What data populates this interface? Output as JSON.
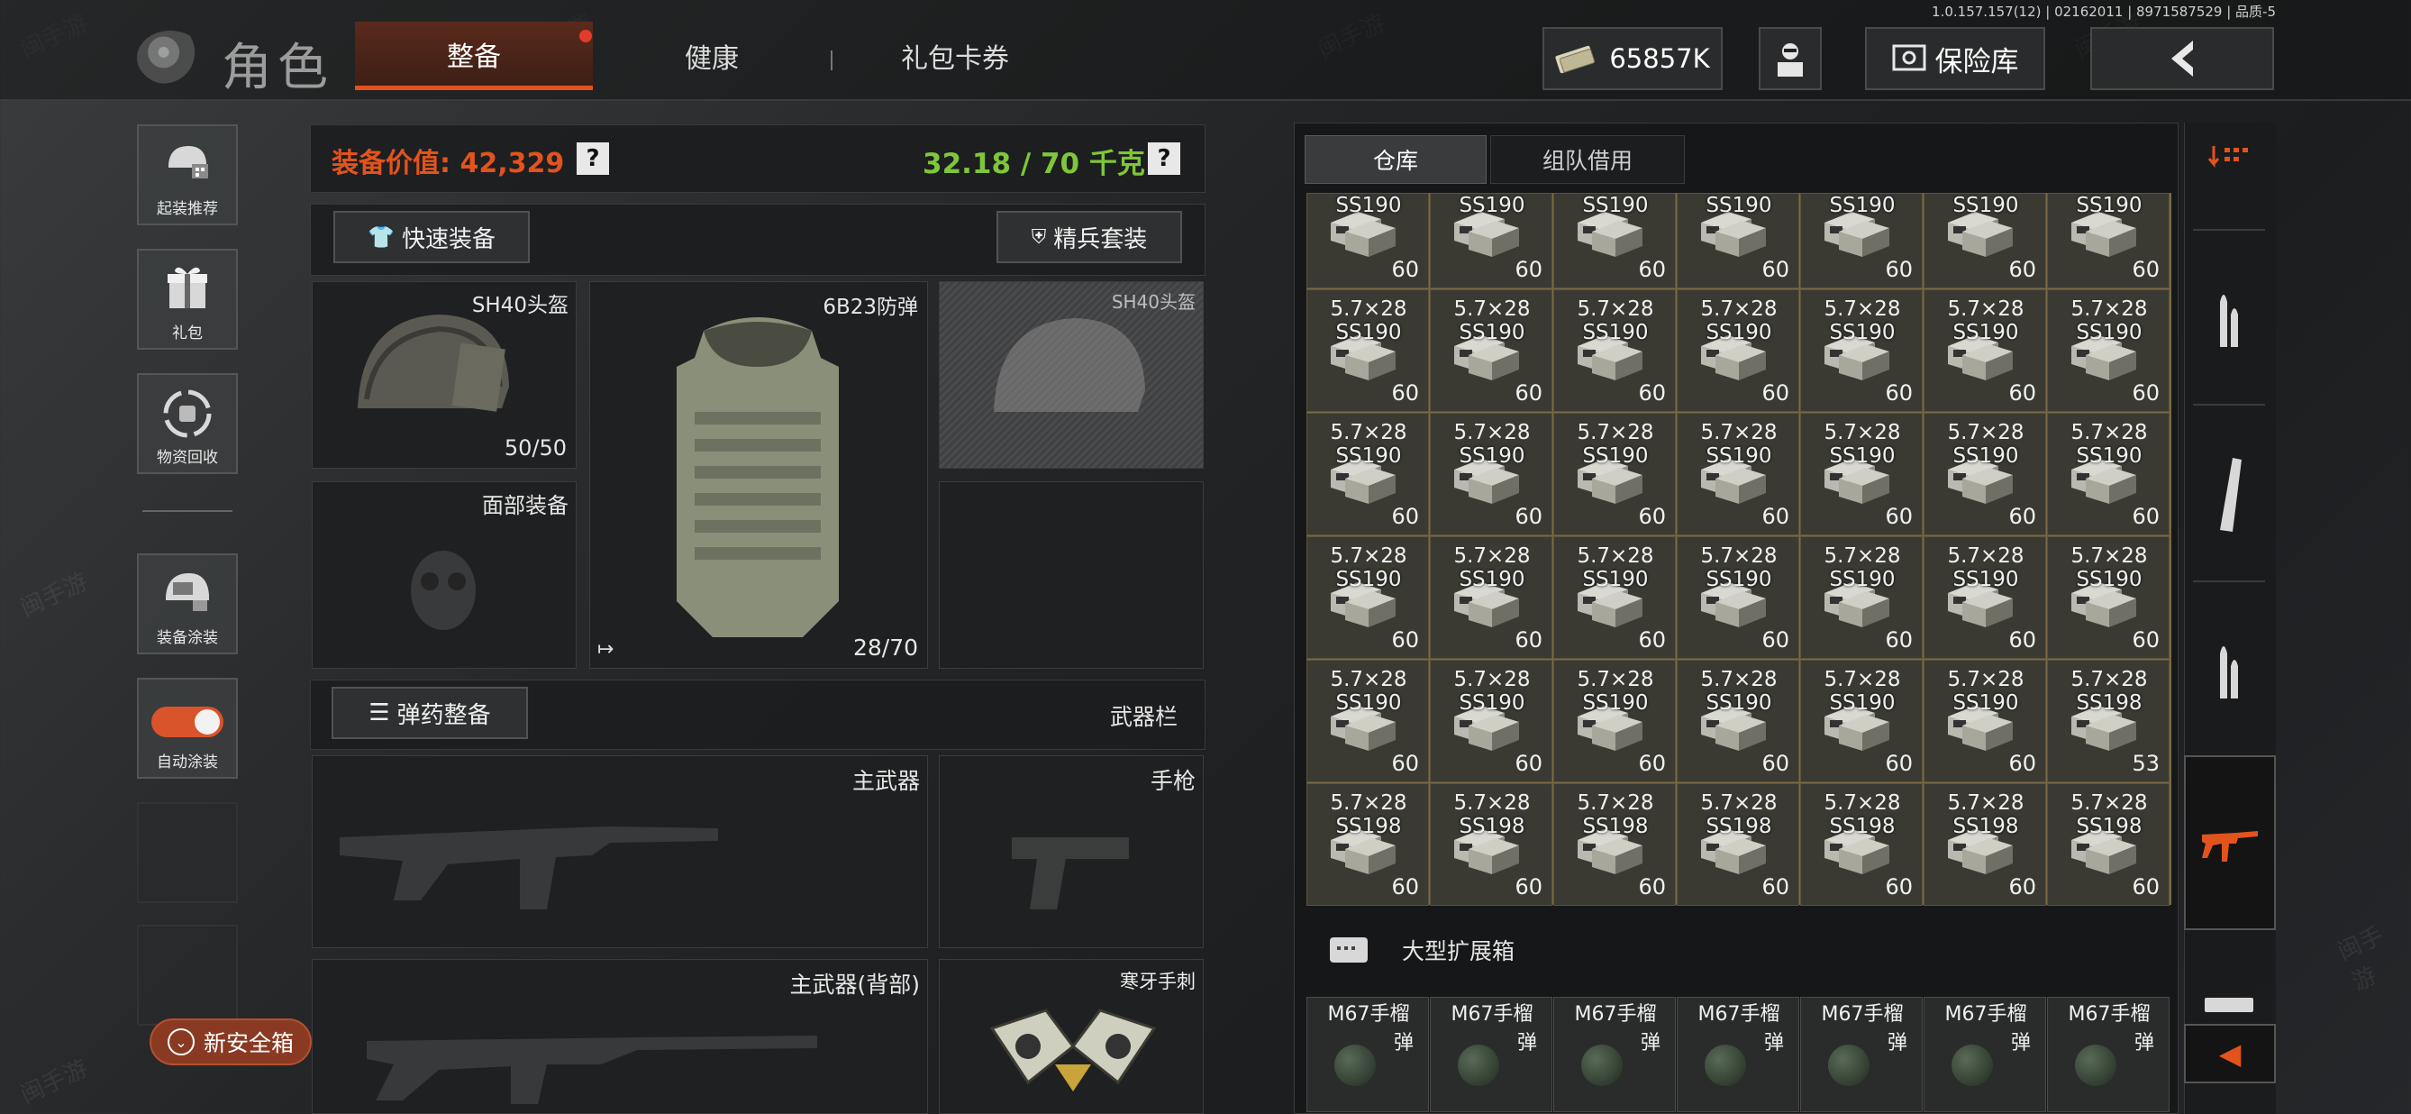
{
  "version": "1.0.157.157(12) | 02162011 | 8971587529 | 品质-5",
  "header": {
    "title": "角色",
    "tabs": [
      "整备",
      "健康",
      "礼包卡券"
    ],
    "currency": "65857K",
    "vault_label": "保险库"
  },
  "sidebar": {
    "items": [
      {
        "label": "起装推荐",
        "icon": "helmet-gun-icon"
      },
      {
        "label": "礼包",
        "icon": "gift-icon"
      },
      {
        "label": "物资回收",
        "icon": "recycle-icon"
      },
      {
        "label": "装备涂装",
        "icon": "helmet-paint-icon"
      },
      {
        "label": "自动涂装",
        "icon": "toggle-icon"
      }
    ],
    "safebox_label": "新安全箱"
  },
  "equipment": {
    "value_label": "装备价值: 42,329",
    "weight_label": "32.18 / 70 千克",
    "quick_equip": "快速装备",
    "elite_set": "精兵套装",
    "helmet_label": "SH40头盔",
    "helmet_durability": "50/50",
    "armor_label": "6B23防弹",
    "armor_durability": "28/70",
    "helmet_ghost_label": "SH40头盔",
    "face_label": "面部装备",
    "ammo_prep": "弹药整备",
    "weapon_bar": "武器栏",
    "primary": "主武器",
    "pistol": "手枪",
    "primary_back": "主武器(背部)",
    "knife": "寒牙手刺"
  },
  "inventory": {
    "tabs": [
      "仓库",
      "组队借用"
    ],
    "grid": [
      [
        {
          "cal": "",
          "ss": "SS190",
          "n": "60"
        },
        {
          "cal": "",
          "ss": "SS190",
          "n": "60"
        },
        {
          "cal": "",
          "ss": "SS190",
          "n": "60"
        },
        {
          "cal": "",
          "ss": "SS190",
          "n": "60"
        },
        {
          "cal": "",
          "ss": "SS190",
          "n": "60"
        },
        {
          "cal": "",
          "ss": "SS190",
          "n": "60"
        },
        {
          "cal": "",
          "ss": "SS190",
          "n": "60"
        }
      ],
      [
        {
          "cal": "5.7×28",
          "ss": "SS190",
          "n": "60"
        },
        {
          "cal": "5.7×28",
          "ss": "SS190",
          "n": "60"
        },
        {
          "cal": "5.7×28",
          "ss": "SS190",
          "n": "60"
        },
        {
          "cal": "5.7×28",
          "ss": "SS190",
          "n": "60"
        },
        {
          "cal": "5.7×28",
          "ss": "SS190",
          "n": "60"
        },
        {
          "cal": "5.7×28",
          "ss": "SS190",
          "n": "60"
        },
        {
          "cal": "5.7×28",
          "ss": "SS190",
          "n": "60"
        }
      ],
      [
        {
          "cal": "5.7×28",
          "ss": "SS190",
          "n": "60"
        },
        {
          "cal": "5.7×28",
          "ss": "SS190",
          "n": "60"
        },
        {
          "cal": "5.7×28",
          "ss": "SS190",
          "n": "60"
        },
        {
          "cal": "5.7×28",
          "ss": "SS190",
          "n": "60"
        },
        {
          "cal": "5.7×28",
          "ss": "SS190",
          "n": "60"
        },
        {
          "cal": "5.7×28",
          "ss": "SS190",
          "n": "60"
        },
        {
          "cal": "5.7×28",
          "ss": "SS190",
          "n": "60"
        }
      ],
      [
        {
          "cal": "5.7×28",
          "ss": "SS190",
          "n": "60"
        },
        {
          "cal": "5.7×28",
          "ss": "SS190",
          "n": "60"
        },
        {
          "cal": "5.7×28",
          "ss": "SS190",
          "n": "60"
        },
        {
          "cal": "5.7×28",
          "ss": "SS190",
          "n": "60"
        },
        {
          "cal": "5.7×28",
          "ss": "SS190",
          "n": "60"
        },
        {
          "cal": "5.7×28",
          "ss": "SS190",
          "n": "60"
        },
        {
          "cal": "5.7×28",
          "ss": "SS190",
          "n": "60"
        }
      ],
      [
        {
          "cal": "5.7×28",
          "ss": "SS190",
          "n": "60"
        },
        {
          "cal": "5.7×28",
          "ss": "SS190",
          "n": "60"
        },
        {
          "cal": "5.7×28",
          "ss": "SS190",
          "n": "60"
        },
        {
          "cal": "5.7×28",
          "ss": "SS190",
          "n": "60"
        },
        {
          "cal": "5.7×28",
          "ss": "SS190",
          "n": "60"
        },
        {
          "cal": "5.7×28",
          "ss": "SS190",
          "n": "60"
        },
        {
          "cal": "5.7×28",
          "ss": "SS198",
          "n": "53"
        }
      ],
      [
        {
          "cal": "5.7×28",
          "ss": "SS198",
          "n": "60"
        },
        {
          "cal": "5.7×28",
          "ss": "SS198",
          "n": "60"
        },
        {
          "cal": "5.7×28",
          "ss": "SS198",
          "n": "60"
        },
        {
          "cal": "5.7×28",
          "ss": "SS198",
          "n": "60"
        },
        {
          "cal": "5.7×28",
          "ss": "SS198",
          "n": "60"
        },
        {
          "cal": "5.7×28",
          "ss": "SS198",
          "n": "60"
        },
        {
          "cal": "5.7×28",
          "ss": "SS198",
          "n": "60"
        }
      ]
    ],
    "container_label": "大型扩展箱",
    "grenade_name_1": "M67手榴",
    "grenade_name_2": "弹",
    "grenade_count": 7
  },
  "watermark": "闽手游",
  "colors": {
    "accent": "#e2531e",
    "value": "#e2531e",
    "weight": "#7ec63a",
    "cell_border": "#7a6a45"
  }
}
